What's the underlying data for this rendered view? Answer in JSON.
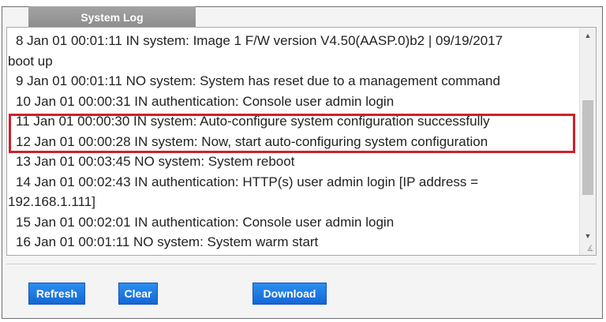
{
  "tab": {
    "title": "System Log"
  },
  "log": {
    "entries": [
      {
        "text": "8 Jan 01 00:01:11 IN system: Image 1 F/W version V4.50(AASP.0)b2 | 09/19/2017"
      },
      {
        "text": "boot up",
        "continuation": true
      },
      {
        "text": "9 Jan 01 00:01:11 NO system: System has reset due to a management command"
      },
      {
        "text": "10 Jan 01 00:00:31 IN authentication: Console user admin login"
      },
      {
        "text": "11 Jan 01 00:00:30 IN system: Auto-configure system configuration successfully",
        "highlighted": true
      },
      {
        "text": "12 Jan 01 00:00:28 IN system: Now, start auto-configuring system configuration",
        "highlighted": true
      },
      {
        "text": "13 Jan 01 00:03:45 NO system: System reboot"
      },
      {
        "text": "14 Jan 01 00:02:43 IN authentication: HTTP(s) user admin login [IP address ="
      },
      {
        "text": "192.168.1.111]",
        "continuation": true
      },
      {
        "text": "15 Jan 01 00:02:01 IN authentication: Console user admin login"
      },
      {
        "text": "16 Jan 01 00:01:11 NO system: System warm start"
      }
    ]
  },
  "buttons": {
    "refresh": "Refresh",
    "clear": "Clear",
    "download": "Download"
  },
  "icons": {
    "scroll_up": "scroll-up-arrow-icon",
    "scroll_down": "scroll-down-arrow-icon",
    "resize": "resize-grip-icon"
  },
  "colors": {
    "button": "#1f7ae0",
    "highlight": "#d0202c",
    "tab": "#999999"
  }
}
